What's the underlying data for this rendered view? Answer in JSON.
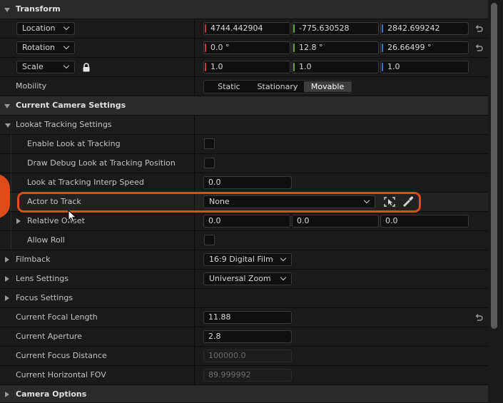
{
  "transform": {
    "header": "Transform",
    "location": {
      "mode": "Location",
      "x": "4744.442904",
      "y": "-775.630528",
      "z": "2842.699242"
    },
    "rotation": {
      "mode": "Rotation",
      "x": "0.0 °",
      "y": "12.8 °",
      "z": "26.66499 °"
    },
    "scale": {
      "mode": "Scale",
      "x": "1.0",
      "y": "1.0",
      "z": "1.0"
    },
    "mobility": {
      "label": "Mobility",
      "options": [
        "Static",
        "Stationary",
        "Movable"
      ],
      "selected": "Movable"
    }
  },
  "camera_settings": {
    "header": "Current Camera Settings",
    "lookat": {
      "header": "Lookat Tracking Settings",
      "enable_look_at": {
        "label": "Enable Look at Tracking",
        "checked": false
      },
      "draw_debug": {
        "label": "Draw Debug Look at Tracking Position",
        "checked": false
      },
      "interp_speed": {
        "label": "Look at Tracking Interp Speed",
        "value": "0.0"
      },
      "actor_to_track": {
        "label": "Actor to Track",
        "value": "None"
      },
      "relative_offset": {
        "label": "Relative Offset",
        "x": "0.0",
        "y": "0.0",
        "z": "0.0"
      },
      "allow_roll": {
        "label": "Allow Roll",
        "checked": false
      }
    },
    "filmback": {
      "label": "Filmback",
      "value": "16:9 Digital Film"
    },
    "lens_settings": {
      "label": "Lens Settings",
      "value": "Universal Zoom"
    },
    "focus_settings": {
      "label": "Focus Settings"
    },
    "focal_length": {
      "label": "Current Focal Length",
      "value": "11.88"
    },
    "aperture": {
      "label": "Current Aperture",
      "value": "2.8"
    },
    "focus_distance": {
      "label": "Current Focus Distance",
      "value": "100000.0"
    },
    "horizontal_fov": {
      "label": "Current Horizontal FOV",
      "value": "89.999992"
    }
  },
  "camera_options": {
    "header": "Camera Options"
  },
  "colors": {
    "axis_x": "#c8343b",
    "axis_y": "#6fa63a",
    "axis_z": "#3f6fc8",
    "highlight": "#e04b1a"
  }
}
